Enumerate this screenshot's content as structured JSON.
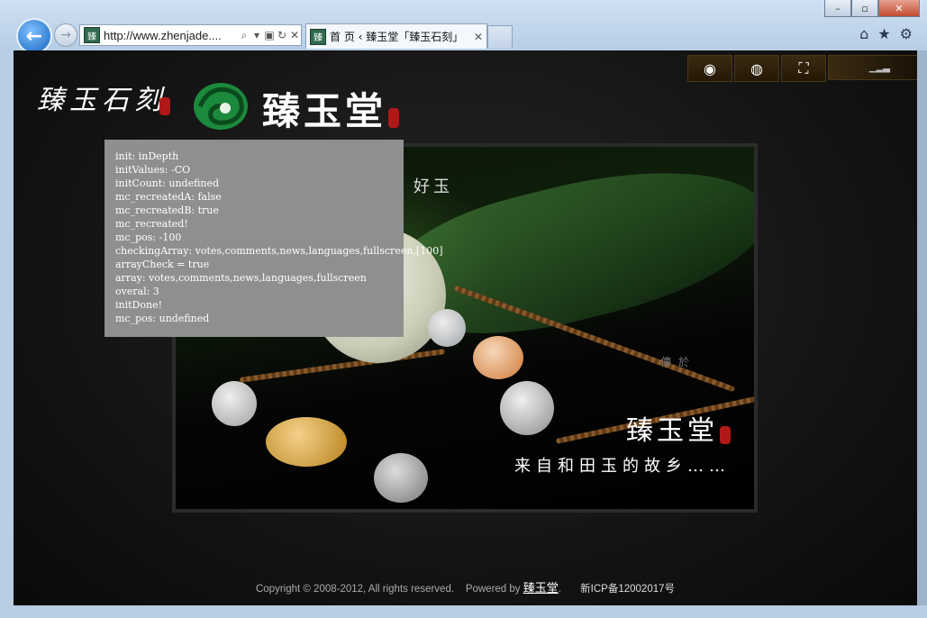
{
  "browser": {
    "address": "http://www.zhenjade....",
    "tab_title": "首 页 ‹ 臻玉堂「臻玉石刻」",
    "favicon": "臻",
    "window_buttons": [
      "–",
      "▫",
      "✕"
    ],
    "icons": [
      "back-arrow-icon",
      "forward-arrow-icon",
      "search-icon",
      "dropdown-icon",
      "compat-icon",
      "refresh-icon",
      "close-icon",
      "home-icon",
      "star-icon",
      "gear-icon"
    ]
  },
  "site": {
    "brand_left": "臻玉石刻",
    "brand_main": "臻玉堂",
    "toolbar": [
      {
        "name": "rss",
        "icon": "rss-icon",
        "glyph": "◉"
      },
      {
        "name": "globe",
        "icon": "globe-icon",
        "glyph": "◍"
      },
      {
        "name": "fullscreen",
        "icon": "fullscreen-icon",
        "glyph": "⛶"
      },
      {
        "name": "volume",
        "icon": "volume-bars-icon",
        "glyph": "▁▂▃"
      }
    ],
    "banner": {
      "small_text": "好玉",
      "faint_text": "傳 於",
      "brand": "臻玉堂",
      "slogan": "来自和田玉的故乡……"
    }
  },
  "debug_lines": [
    "init: inDepth",
    "initValues: -CO",
    "initCount: undefined",
    "mc_recreatedA: false",
    "mc_recreatedB: true",
    "mc_recreated!",
    "mc_pos: -100",
    "checkingArray: votes,comments,news,languages,fullscreen,[100]",
    "arrayCheck = true",
    "array: votes,comments,news,languages,fullscreen",
    "overal: 3",
    "initDone!",
    "mc_pos: undefined"
  ],
  "footer": {
    "copyright": "Copyright © 2008-2012, All rights reserved.",
    "powered_by": "Powered by",
    "powered_link": "臻玉堂",
    "period": ".",
    "icp": "新ICP备12002017号"
  }
}
